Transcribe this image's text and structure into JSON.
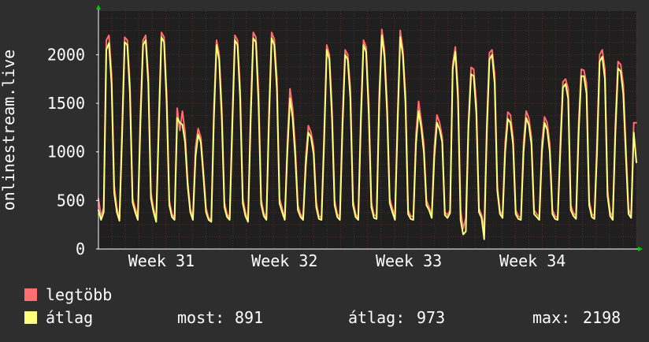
{
  "chart_data": {
    "type": "line",
    "ylabel": "onlinestream.live",
    "ylim": [
      0,
      2450
    ],
    "yticks": [
      0,
      500,
      1000,
      1500,
      2000
    ],
    "x_tick_labels": [
      "Week 31",
      "Week 32",
      "Week 33",
      "Week 34"
    ],
    "grid": true,
    "colors": {
      "background": "#2e2e2e",
      "plot_bg": "#1f1f1f",
      "grid": "#5a2a2a",
      "axis": "#ffffff",
      "arrow": "#00cc00",
      "series_max": "#ff6f6f",
      "series_avg": "#ffff7a"
    },
    "series": [
      {
        "name": "legtöbb",
        "color": "#ff6f6f",
        "values": [
          520,
          330,
          430,
          2150,
          2200,
          1800,
          650,
          430,
          310,
          1250,
          2180,
          2150,
          1700,
          520,
          420,
          340,
          1400,
          2150,
          2200,
          1780,
          580,
          420,
          300,
          1350,
          2230,
          2180,
          1600,
          500,
          360,
          320,
          1450,
          1220,
          1420,
          1200,
          700,
          410,
          330,
          1050,
          1240,
          1150,
          800,
          420,
          320,
          300,
          1450,
          2150,
          2000,
          1450,
          480,
          360,
          320,
          1350,
          2200,
          2150,
          1650,
          520,
          380,
          300,
          1420,
          2230,
          2180,
          1620,
          510,
          370,
          320,
          1430,
          2230,
          2160,
          1760,
          520,
          420,
          320,
          1100,
          1650,
          1450,
          1050,
          450,
          360,
          320,
          950,
          1270,
          1200,
          1050,
          480,
          340,
          320,
          1200,
          2100,
          2000,
          1450,
          500,
          360,
          330,
          1350,
          2050,
          2000,
          1650,
          500,
          360,
          320,
          1400,
          2150,
          2080,
          1500,
          480,
          350,
          340,
          1600,
          2260,
          2050,
          1500,
          520,
          420,
          330,
          1380,
          2250,
          2050,
          1600,
          400,
          340,
          330,
          1180,
          1520,
          1320,
          1080,
          500,
          430,
          350,
          1050,
          1380,
          1300,
          1150,
          380,
          350,
          400,
          1900,
          2080,
          1650,
          400,
          210,
          320,
          1310,
          1870,
          1850,
          1500,
          420,
          350,
          200,
          1300,
          2020,
          2050,
          1800,
          650,
          390,
          350,
          1100,
          1410,
          1380,
          1150,
          400,
          340,
          320,
          1100,
          1420,
          1350,
          1150,
          400,
          360,
          330,
          1100,
          1360,
          1300,
          1080,
          400,
          340,
          320,
          1100,
          1720,
          1750,
          1650,
          450,
          370,
          340,
          1300,
          1850,
          1840,
          1700,
          500,
          360,
          340,
          1100,
          2000,
          2050,
          1850,
          600,
          380,
          330,
          1300,
          1930,
          1900,
          1700,
          1050,
          410,
          350,
          1300,
          1300
        ]
      },
      {
        "name": "átlag",
        "color": "#ffff7a",
        "values": [
          400,
          300,
          380,
          2050,
          2120,
          1700,
          580,
          380,
          290,
          1150,
          2130,
          2100,
          1600,
          480,
          380,
          300,
          1300,
          2100,
          2150,
          1700,
          520,
          380,
          280,
          1250,
          2180,
          2130,
          1500,
          450,
          330,
          300,
          1350,
          1300,
          1280,
          1100,
          650,
          380,
          300,
          950,
          1180,
          1100,
          750,
          380,
          300,
          280,
          1350,
          2100,
          1950,
          1350,
          430,
          330,
          300,
          1250,
          2150,
          2100,
          1550,
          470,
          340,
          280,
          1320,
          2170,
          2130,
          1500,
          460,
          340,
          300,
          1330,
          2170,
          2100,
          1650,
          470,
          380,
          300,
          1000,
          1550,
          1350,
          950,
          400,
          330,
          300,
          850,
          1200,
          1150,
          980,
          430,
          310,
          300,
          1100,
          2050,
          1950,
          1350,
          450,
          330,
          300,
          1250,
          2000,
          1950,
          1550,
          450,
          330,
          300,
          1300,
          2100,
          2030,
          1400,
          430,
          320,
          310,
          1500,
          2200,
          1980,
          1400,
          470,
          380,
          300,
          1280,
          2180,
          2000,
          1500,
          360,
          310,
          300,
          1080,
          1420,
          1250,
          1000,
          450,
          400,
          320,
          950,
          1300,
          1230,
          1100,
          350,
          320,
          370,
          1850,
          2030,
          1550,
          300,
          150,
          180,
          1250,
          1800,
          1780,
          1400,
          380,
          320,
          100,
          1200,
          1950,
          2000,
          1700,
          600,
          360,
          320,
          1000,
          1340,
          1300,
          1080,
          360,
          310,
          300,
          1000,
          1350,
          1280,
          1080,
          360,
          330,
          300,
          1000,
          1300,
          1230,
          1000,
          360,
          310,
          300,
          1000,
          1660,
          1700,
          1550,
          400,
          340,
          310,
          1200,
          1780,
          1780,
          1600,
          450,
          330,
          310,
          1000,
          1930,
          1980,
          1750,
          550,
          340,
          300,
          1200,
          1860,
          1830,
          1600,
          950,
          360,
          320,
          1200,
          891
        ]
      }
    ]
  },
  "legend": {
    "items": [
      {
        "label": "legtöbb",
        "color": "#ff6f6f"
      },
      {
        "label": "átlag",
        "color": "#ffff7a"
      }
    ],
    "stats": {
      "most_label": "most:",
      "most_value": "891",
      "atlag_label": "átlag:",
      "atlag_value": "973",
      "max_label": "max:",
      "max_value": "2198"
    }
  }
}
